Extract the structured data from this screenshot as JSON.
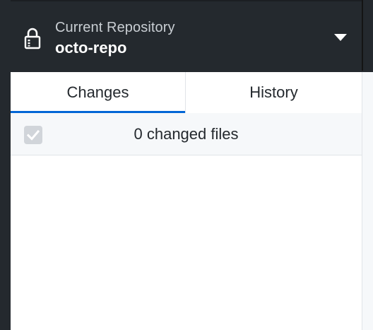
{
  "repository": {
    "label": "Current Repository",
    "name": "octo-repo",
    "lock_icon": "lock-icon",
    "dropdown_icon": "caret-down-icon"
  },
  "tabs": [
    {
      "label": "Changes",
      "selected": true
    },
    {
      "label": "History",
      "selected": false
    }
  ],
  "changes": {
    "summary": "0 changed files",
    "select_all_checked": true,
    "select_all_disabled": true,
    "files": []
  },
  "colors": {
    "header_bg": "#24292e",
    "accent": "#0366d6",
    "panel_bg": "#ffffff",
    "subheader_bg": "#f6f8fa"
  }
}
